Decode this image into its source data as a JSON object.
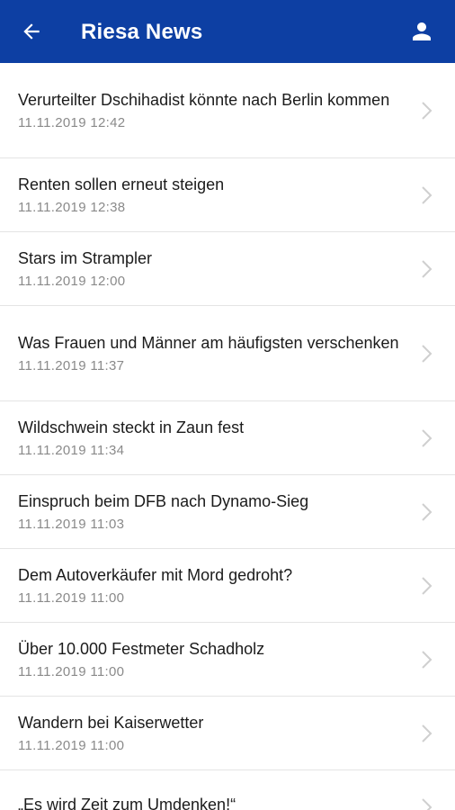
{
  "header": {
    "title": "Riesa News",
    "back_icon": "arrow-left-icon",
    "user_icon": "user-icon",
    "background_color": "#0d3fa3"
  },
  "articles": [
    {
      "headline": "Verurteilter Dschihadist könnte nach Berlin kommen",
      "date": "11.11.2019 12:42"
    },
    {
      "headline": "Renten sollen erneut steigen",
      "date": "11.11.2019 12:38"
    },
    {
      "headline": "Stars im Strampler",
      "date": "11.11.2019 12:00"
    },
    {
      "headline": "Was Frauen und Männer am häufigsten verschenken",
      "date": "11.11.2019 11:37"
    },
    {
      "headline": "Wildschwein steckt in Zaun fest",
      "date": "11.11.2019 11:34"
    },
    {
      "headline": "Einspruch beim DFB nach Dynamo-Sieg",
      "date": "11.11.2019 11:03"
    },
    {
      "headline": "Dem Autoverkäufer mit Mord gedroht?",
      "date": "11.11.2019 11:00"
    },
    {
      "headline": "Über 10.000 Festmeter Schadholz",
      "date": "11.11.2019 11:00"
    },
    {
      "headline": "Wandern bei Kaiserwetter",
      "date": "11.11.2019 11:00"
    },
    {
      "headline": "„Es wird Zeit zum Umdenken!“",
      "date": ""
    }
  ],
  "chevron_icon": "chevron-right-icon"
}
